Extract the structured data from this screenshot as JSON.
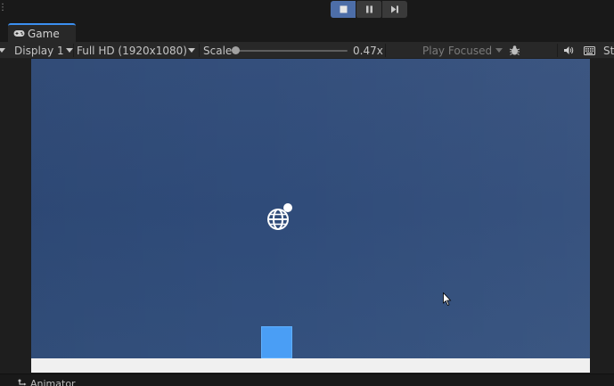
{
  "play_controls": {
    "stop_icon": "stop-icon",
    "pause_icon": "pause-icon",
    "step_icon": "step-forward-icon"
  },
  "tab": {
    "label": "Game",
    "icon": "gamepad-icon"
  },
  "toolbar": {
    "display": "Display 1",
    "resolution": "Full HD (1920x1080)",
    "scale_label": "Scale",
    "scale_value": "0.47x",
    "scale_fraction": 0.47,
    "play_mode": "Play Focused",
    "bug_icon": "bug-icon",
    "audio_icon": "speaker-icon",
    "keyboard_icon": "keyboard-icon",
    "stats_label": "St"
  },
  "game": {
    "sky_color": "#2f4b79",
    "ground_color": "#f0f0f0",
    "block_color": "#4a9ef5",
    "globe_icon": "globe-icon"
  },
  "bottom": {
    "tab_label": "Animator",
    "tab_icon": "animator-icon"
  }
}
